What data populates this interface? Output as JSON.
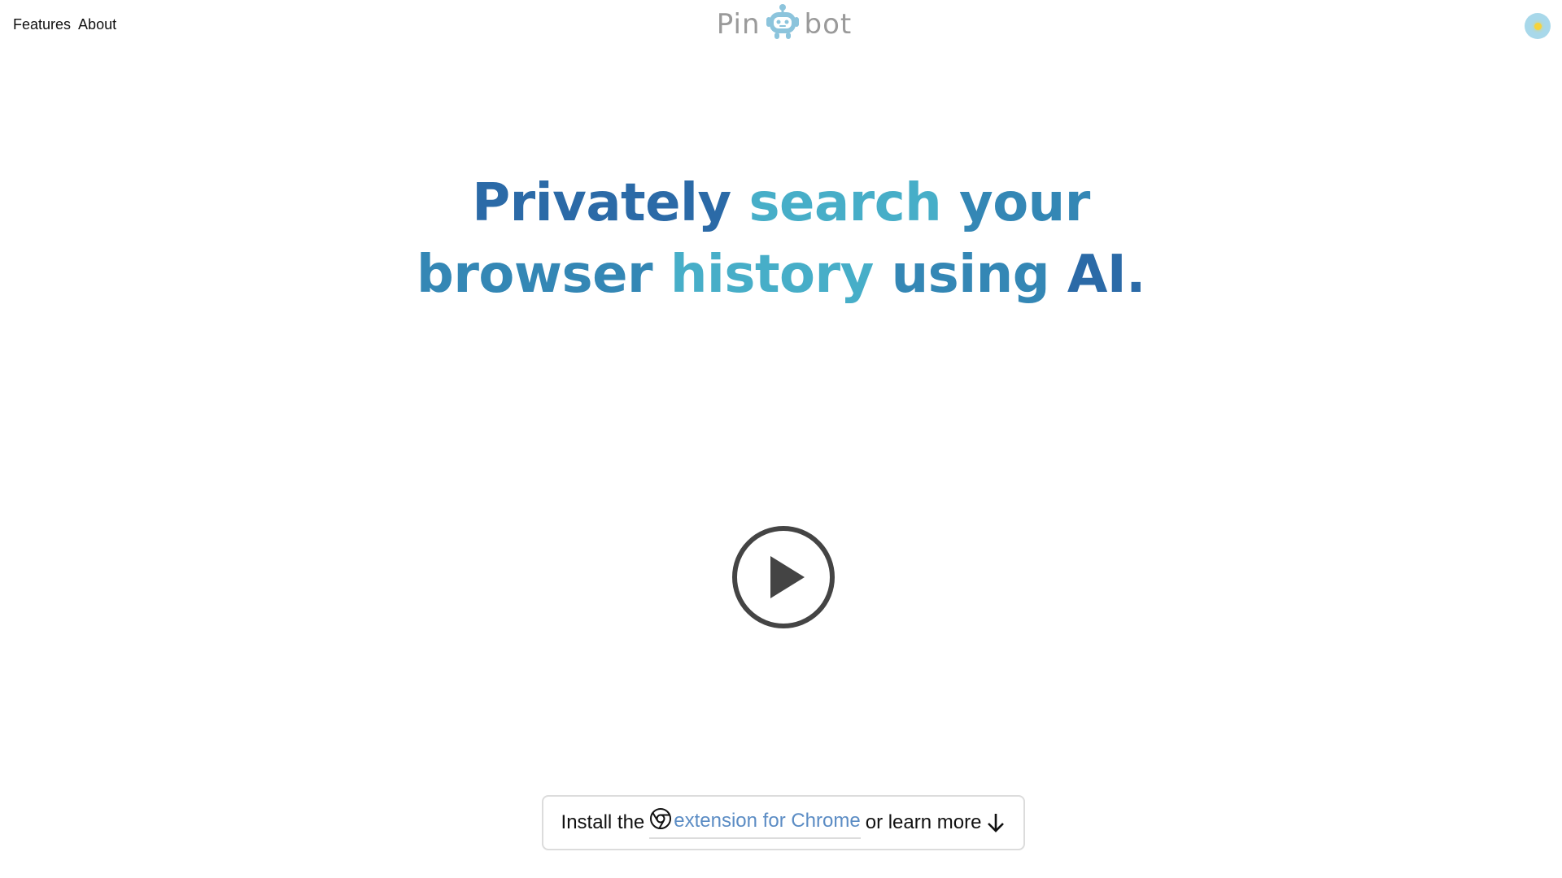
{
  "nav": {
    "links": [
      "Features",
      "About"
    ]
  },
  "logo": {
    "left": "Pin",
    "right": "bot",
    "icon": "robot-icon"
  },
  "theme_toggle": {
    "icon": "sun-icon"
  },
  "hero": {
    "line1": [
      "Privately",
      "search",
      "your"
    ],
    "line2": [
      "browser",
      "history",
      "using",
      "AI."
    ]
  },
  "video": {
    "icon": "play-icon"
  },
  "cta": {
    "prefix": "Install the",
    "link_icon": "chrome-icon",
    "link_text": "extension for Chrome",
    "suffix": "or learn more",
    "arrow_icon": "arrow-down-icon"
  },
  "colors": {
    "accent_dark": "#2b6aa7",
    "accent_light": "#47aec8",
    "link": "#5b8cc4",
    "logo": "#9a9a9a",
    "robot": "#8cc4dc"
  }
}
